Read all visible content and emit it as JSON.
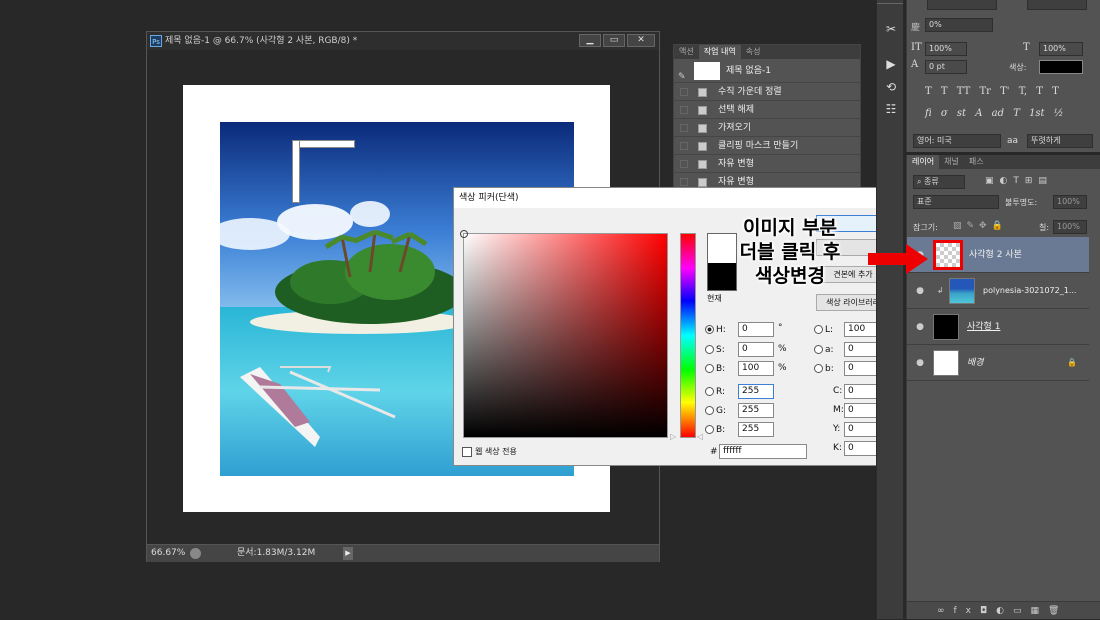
{
  "document": {
    "ps_badge": "Ps",
    "title": "제목 없음-1 @ 66.7% (사각형 2 사본, RGB/8) *",
    "zoom": "66.67%",
    "doc_info": "문서:1.83M/3.12M"
  },
  "history_panel": {
    "tabs": [
      "액션",
      "작업 내역",
      "속성"
    ],
    "snapshot_label": "제목 없음-1",
    "items": [
      "수직 가운데 정렬",
      "선택 해제",
      "가져오기",
      "클리핑 마스크 만들기",
      "자유 변형",
      "자유 변형"
    ]
  },
  "color_picker": {
    "title": "색상 피커(단색)",
    "close": "✕",
    "current_label": "현재",
    "add_swatch": "견본에 추가",
    "library": "색상 라이브러리",
    "web_only": "웹 색상 전용",
    "hsb": {
      "h": "0",
      "s": "0",
      "b": "100",
      "h_unit": "°",
      "s_unit": "%",
      "b_unit": "%"
    },
    "lab": {
      "l": "100",
      "a": "0",
      "b": "0"
    },
    "rgb": {
      "r": "255",
      "g": "255",
      "b": "255"
    },
    "cmyk": {
      "c": "0",
      "m": "0",
      "y": "0",
      "k": "0",
      "unit": "%"
    },
    "hex": "ffffff",
    "labels": {
      "h": "H:",
      "s": "S:",
      "bb": "B:",
      "r": "R:",
      "g": "G:",
      "b": "B:",
      "l": "L:",
      "a": "a:",
      "lb": "b:",
      "c": "C:",
      "m": "M:",
      "y": "Y:",
      "k": "K:",
      "hash": "#"
    }
  },
  "character_panel": {
    "field1": "0%",
    "size1": "100%",
    "size2": "100%",
    "baseline": "0 pt",
    "color_label": "색상:",
    "language": "영어: 미국",
    "aa_label": "aa",
    "aa_value": "뚜렷하게",
    "type_buttons": [
      "T",
      "T",
      "TT",
      "Tr",
      "T'",
      "T,",
      "T",
      "T"
    ],
    "ot_buttons": [
      "fi",
      "σ",
      "st",
      "A",
      "ad",
      "T",
      "1st",
      "½"
    ]
  },
  "layers_panel": {
    "tabs": [
      "레이어",
      "채널",
      "패스"
    ],
    "filter": "종류",
    "blend_mode": "표준",
    "opacity_label": "불투명도:",
    "opacity": "100%",
    "lock_label": "잠그기:",
    "fill_label": "칠:",
    "fill": "100%",
    "layers": [
      {
        "name": "사각형 2 사본"
      },
      {
        "name": "polynesia-3021072_1..."
      },
      {
        "name": "사각형 1"
      },
      {
        "name": "배경"
      }
    ]
  },
  "annotation": {
    "line1": "이미지 부분",
    "line2": "더블 클릭 후",
    "line3": "색상변경"
  }
}
